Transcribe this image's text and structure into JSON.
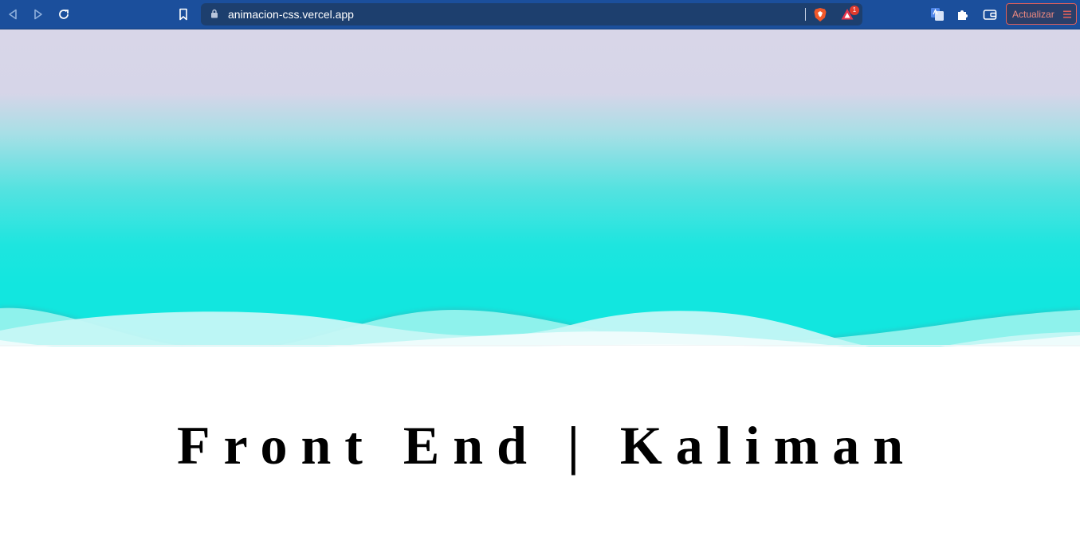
{
  "browser": {
    "url": "animacion-css.vercel.app",
    "rewards_badge": "1",
    "update_label": "Actualizar"
  },
  "page": {
    "title": "Front End | Kaliman"
  },
  "colors": {
    "toolbar": "#1b4f9c",
    "urlbar": "#1d3f6e",
    "hero_top": "#d8d6e8",
    "hero_bottom": "#12e6df",
    "update_border": "#e0605a"
  },
  "icons": [
    "back-icon",
    "forward-icon",
    "reload-icon",
    "bookmark-icon",
    "lock-icon",
    "brave-shields-icon",
    "brave-rewards-icon",
    "translate-icon",
    "extensions-icon",
    "wallet-icon",
    "menu-icon"
  ]
}
